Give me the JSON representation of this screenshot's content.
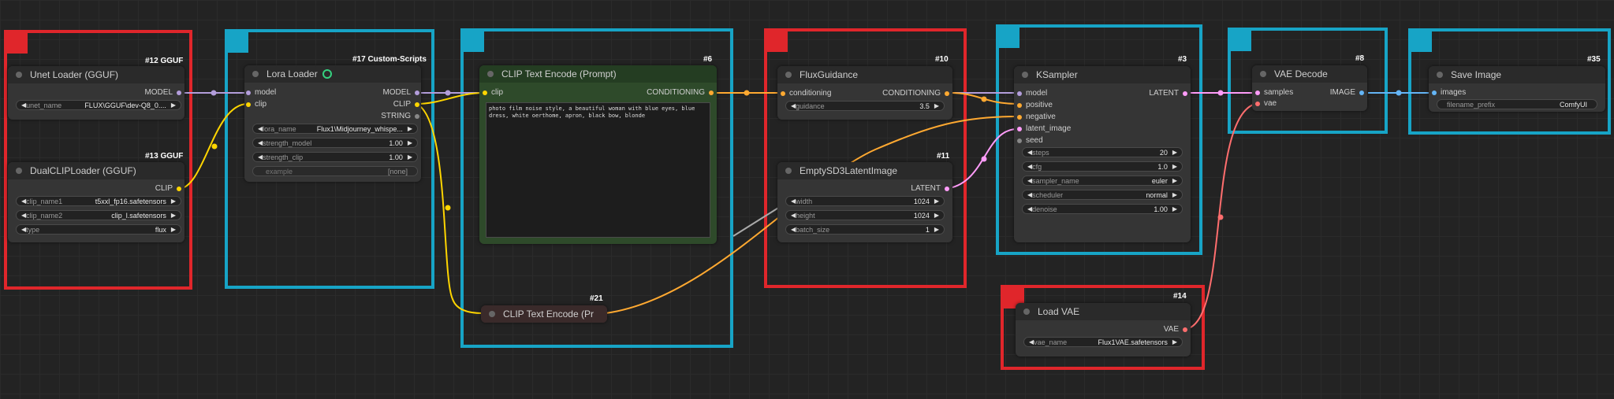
{
  "colors": {
    "red_group": "#e0262b",
    "blue_group": "#17a4c6",
    "model": "#b39ddb",
    "clip": "#ffd500",
    "conditioning": "#ffa931",
    "latent": "#ff9cf9",
    "vae": "#ff6e6e",
    "image": "#64b5f6"
  },
  "nodes": {
    "unet": {
      "id": "#12 GGUF",
      "title": "Unet Loader (GGUF)",
      "out_model": "MODEL",
      "unet_name_label": "unet_name",
      "unet_name_value": "FLUX\\GGUF\\dev-Q8_0...."
    },
    "dualclip": {
      "id": "#13 GGUF",
      "title": "DualCLIPLoader (GGUF)",
      "out_clip": "CLIP",
      "clip_name1_label": "clip_name1",
      "clip_name1_value": "t5xxl_fp16.safetensors",
      "clip_name2_label": "clip_name2",
      "clip_name2_value": "clip_l.safetensors",
      "type_label": "type",
      "type_value": "flux"
    },
    "lora": {
      "id": "#17 Custom-Scripts",
      "title": "Lora Loader",
      "in_model": "model",
      "in_clip": "clip",
      "out_model": "MODEL",
      "out_clip": "CLIP",
      "out_string": "STRING",
      "lora_name_label": "lora_name",
      "lora_name_value": "Flux1\\Midjourney_whispe...",
      "strength_model_label": "strength_model",
      "strength_model_value": "1.00",
      "strength_clip_label": "strength_clip",
      "strength_clip_value": "1.00",
      "example_label": "example",
      "example_value": "[none]"
    },
    "clip_encode": {
      "id": "#6",
      "title": "CLIP Text Encode (Prompt)",
      "in_clip": "clip",
      "out_conditioning": "CONDITIONING",
      "prompt": "photo film noise style, a beautiful woman with blue eyes, blue dress, white oerthome, apron, black bow, blonde"
    },
    "clip_encode2": {
      "id": "#21",
      "title": "CLIP Text Encode (Pr"
    },
    "flux_guidance": {
      "id": "#10",
      "title": "FluxGuidance",
      "in_conditioning": "conditioning",
      "out_conditioning": "CONDITIONING",
      "guidance_label": "guidance",
      "guidance_value": "3.5"
    },
    "empty_latent": {
      "id": "#11",
      "title": "EmptySD3LatentImage",
      "out_latent": "LATENT",
      "width_label": "width",
      "width_value": "1024",
      "height_label": "height",
      "height_value": "1024",
      "batch_label": "batch_size",
      "batch_value": "1"
    },
    "ksampler": {
      "id": "#3",
      "title": "KSampler",
      "in_model": "model",
      "in_positive": "positive",
      "in_negative": "negative",
      "in_latent": "latent_image",
      "in_seed": "seed",
      "out_latent": "LATENT",
      "steps_label": "steps",
      "steps_value": "20",
      "cfg_label": "cfg",
      "cfg_value": "1.0",
      "sampler_label": "sampler_name",
      "sampler_value": "euler",
      "scheduler_label": "scheduler",
      "scheduler_value": "normal",
      "denoise_label": "denoise",
      "denoise_value": "1.00"
    },
    "vae_decode": {
      "id": "#8",
      "title": "VAE Decode",
      "in_samples": "samples",
      "in_vae": "vae",
      "out_image": "IMAGE"
    },
    "save_image": {
      "id": "#35",
      "title": "Save Image",
      "in_images": "images",
      "prefix_label": "filename_prefix",
      "prefix_value": "ComfyUI"
    },
    "load_vae": {
      "id": "#14",
      "title": "Load VAE",
      "out_vae": "VAE",
      "vae_name_label": "vae_name",
      "vae_name_value": "Flux1VAE.safetensors"
    }
  }
}
